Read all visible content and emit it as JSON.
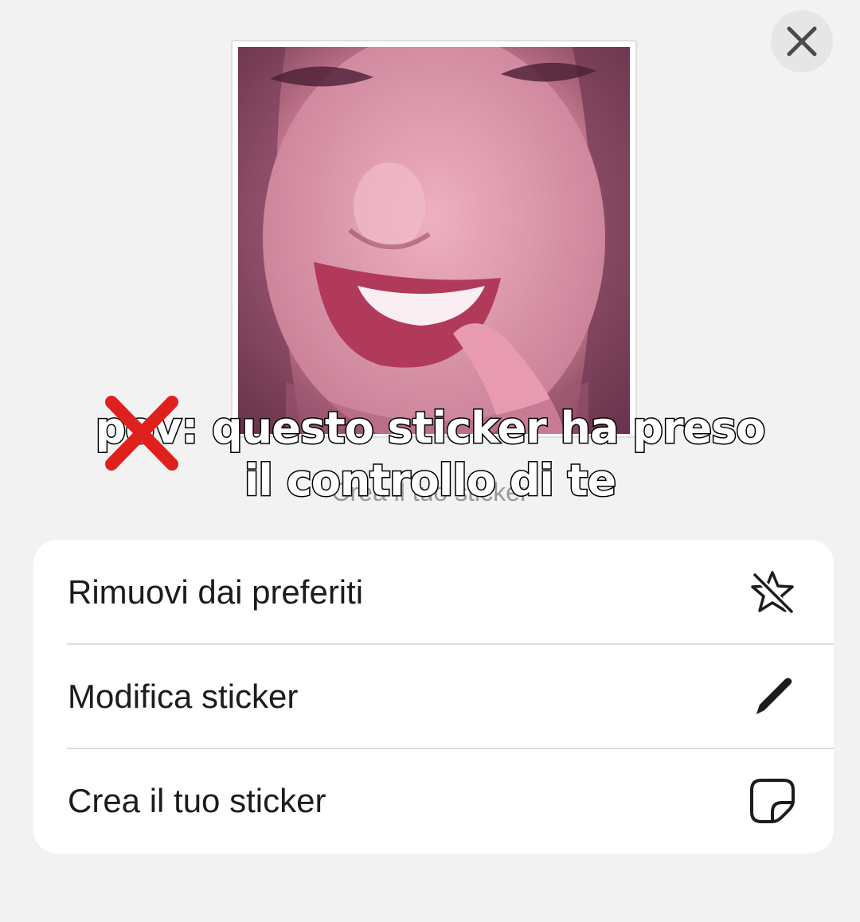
{
  "sticker": {
    "caption": "Crea il tuo sticker"
  },
  "overlay_text": {
    "line1": "pov: questo sticker ha preso",
    "line2": "il controllo di te"
  },
  "menu": {
    "items": [
      {
        "label": "Rimuovi dai preferiti",
        "icon": "unfavorite-star-icon"
      },
      {
        "label": "Modifica sticker",
        "icon": "pencil-icon"
      },
      {
        "label": "Crea il tuo sticker",
        "icon": "sticker-icon"
      }
    ]
  },
  "colors": {
    "background": "#f2f2f2",
    "card": "#ffffff",
    "cross": "#e0201c"
  }
}
